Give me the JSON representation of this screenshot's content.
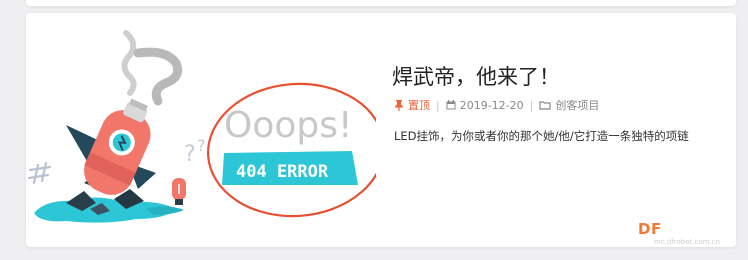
{
  "post": {
    "title": "焊武帝，他来了！",
    "pin_label": "置顶",
    "date": "2019-12-20",
    "category": "创客项目",
    "excerpt": "LED挂饰，为你或者你的那个她/他/它打造一条独特的项链"
  },
  "thumbnail": {
    "ooops_text": "Ooops!",
    "error_text": "404 ERROR"
  },
  "watermark": {
    "logo": "DF",
    "sub": "mc.dfrobot.com.cn"
  },
  "colors": {
    "accent": "#f0623a",
    "annotation_circle": "#e8502f",
    "error_banner": "#2cc6d6"
  }
}
